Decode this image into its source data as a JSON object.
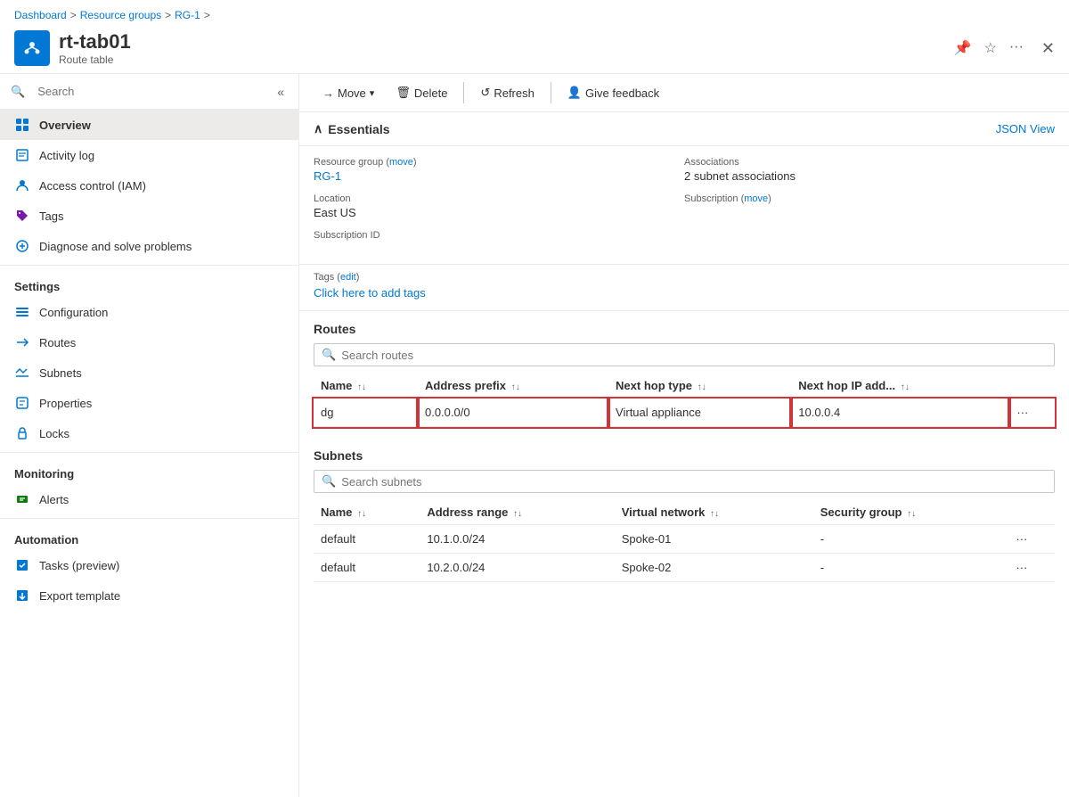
{
  "breadcrumb": {
    "items": [
      "Dashboard",
      "Resource groups",
      "RG-1"
    ],
    "separators": [
      ">",
      ">",
      ">"
    ]
  },
  "resource": {
    "title": "rt-tab01",
    "subtitle": "Route table",
    "icon": "🗺"
  },
  "header_actions": {
    "pin_icon": "📌",
    "star_icon": "☆",
    "more_icon": "...",
    "close_icon": "✕"
  },
  "search": {
    "placeholder": "Search"
  },
  "toolbar": {
    "move_label": "Move",
    "delete_label": "Delete",
    "refresh_label": "Refresh",
    "feedback_label": "Give feedback"
  },
  "sidebar": {
    "nav_items": [
      {
        "id": "overview",
        "label": "Overview",
        "active": true
      },
      {
        "id": "activity-log",
        "label": "Activity log",
        "active": false
      },
      {
        "id": "access-control",
        "label": "Access control (IAM)",
        "active": false
      },
      {
        "id": "tags",
        "label": "Tags",
        "active": false
      },
      {
        "id": "diagnose",
        "label": "Diagnose and solve problems",
        "active": false
      }
    ],
    "settings_label": "Settings",
    "settings_items": [
      {
        "id": "configuration",
        "label": "Configuration"
      },
      {
        "id": "routes",
        "label": "Routes"
      },
      {
        "id": "subnets",
        "label": "Subnets"
      },
      {
        "id": "properties",
        "label": "Properties"
      },
      {
        "id": "locks",
        "label": "Locks"
      }
    ],
    "monitoring_label": "Monitoring",
    "monitoring_items": [
      {
        "id": "alerts",
        "label": "Alerts"
      }
    ],
    "automation_label": "Automation",
    "automation_items": [
      {
        "id": "tasks",
        "label": "Tasks (preview)"
      },
      {
        "id": "export-template",
        "label": "Export template"
      }
    ]
  },
  "essentials": {
    "title": "Essentials",
    "json_view_label": "JSON View",
    "fields": [
      {
        "label": "Resource group (move)",
        "value": "RG-1",
        "is_link": true,
        "link_text": "RG-1"
      },
      {
        "label": "Associations",
        "value": "2 subnet associations",
        "is_link": false
      },
      {
        "label": "Location",
        "value": "East US",
        "is_link": false
      },
      {
        "label": "Subscription (move)",
        "value": "",
        "is_link": false
      },
      {
        "label": "Subscription ID",
        "value": "",
        "is_link": false
      }
    ],
    "tags_label": "Tags (edit)",
    "tags_cta": "Click here to add tags"
  },
  "routes_section": {
    "title": "Routes",
    "search_placeholder": "Search routes",
    "columns": [
      "Name",
      "Address prefix",
      "Next hop type",
      "Next hop IP add..."
    ],
    "rows": [
      {
        "name": "dg",
        "address_prefix": "0.0.0.0/0",
        "next_hop_type": "Virtual appliance",
        "next_hop_ip": "10.0.0.4",
        "selected": true
      }
    ]
  },
  "subnets_section": {
    "title": "Subnets",
    "search_placeholder": "Search subnets",
    "columns": [
      "Name",
      "Address range",
      "Virtual network",
      "Security group"
    ],
    "rows": [
      {
        "name": "default",
        "address_range": "10.1.0.0/24",
        "virtual_network": "Spoke-01",
        "security_group": "-"
      },
      {
        "name": "default",
        "address_range": "10.2.0.0/24",
        "virtual_network": "Spoke-02",
        "security_group": "-"
      }
    ]
  }
}
